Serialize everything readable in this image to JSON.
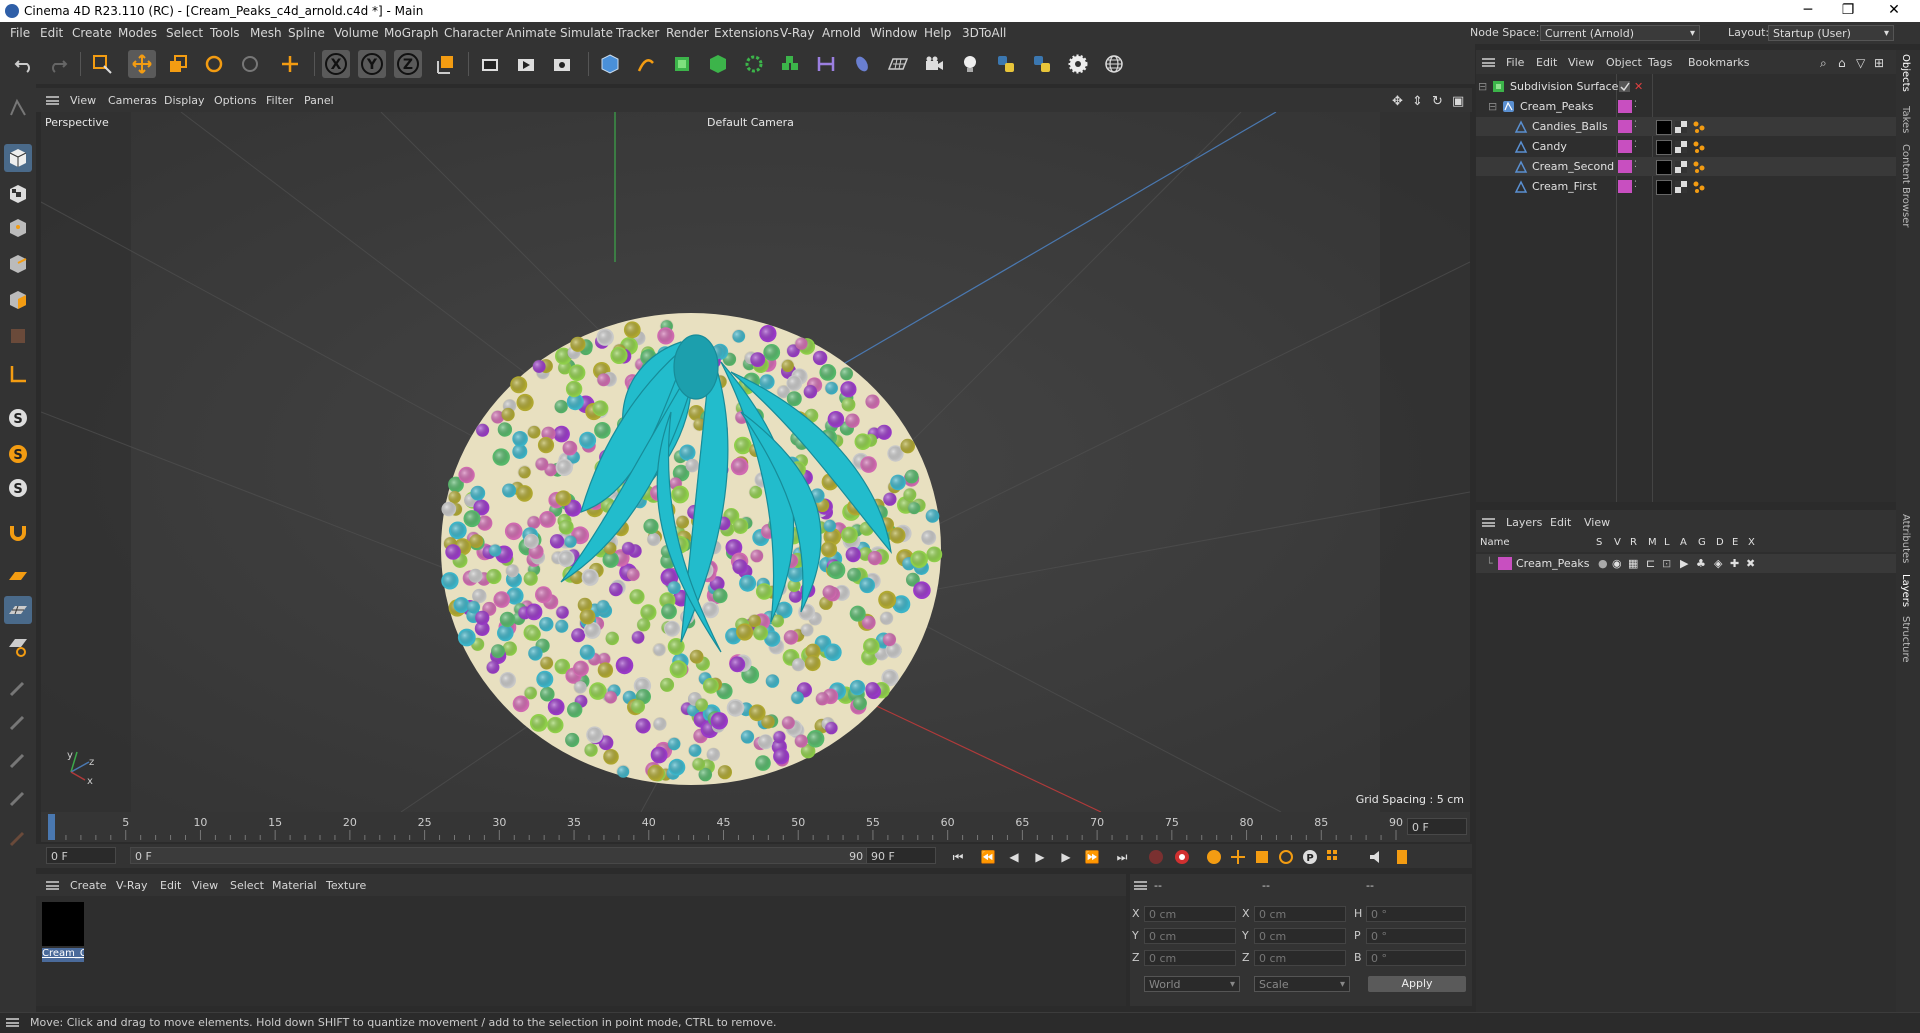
{
  "window": {
    "title": "Cinema 4D R23.110 (RC) - [Cream_Peaks_c4d_arnold.c4d *] - Main",
    "minimize": "─",
    "maximize": "❐",
    "close": "✕"
  },
  "menubar": {
    "items": [
      "File",
      "Edit",
      "Create",
      "Modes",
      "Select",
      "Tools",
      "Mesh",
      "Spline",
      "Volume",
      "MoGraph",
      "Character",
      "Animate",
      "Simulate",
      "Tracker",
      "Render",
      "Extensions",
      "V-Ray",
      "Arnold",
      "Window",
      "Help",
      "3DToAll"
    ],
    "node_space_label": "Node Space:",
    "node_space_value": "Current (Arnold)",
    "layout_label": "Layout:",
    "layout_value": "Startup (User)"
  },
  "viewport": {
    "menu": [
      "View",
      "Cameras",
      "Display",
      "Options",
      "Filter",
      "Panel"
    ],
    "projection": "Perspective",
    "camera": "Default Camera",
    "grid_spacing": "Grid Spacing : 5 cm",
    "axis_y": "y",
    "axis_z": "z",
    "axis_x": "x"
  },
  "timeline": {
    "ticks": [
      "0",
      "5",
      "10",
      "15",
      "20",
      "25",
      "30",
      "35",
      "40",
      "45",
      "50",
      "55",
      "60",
      "65",
      "70",
      "75",
      "80",
      "85",
      "90"
    ],
    "current_frame": "0 F",
    "start_frame": "0 F",
    "range_start": "0 F",
    "range_end": "90 F",
    "end_frame": "90 F"
  },
  "material_manager": {
    "menu": [
      "Create",
      "V-Ray",
      "Edit",
      "View",
      "Select",
      "Material",
      "Texture"
    ],
    "material_name": "Cream_C"
  },
  "coordinates": {
    "header": [
      "--",
      "--",
      "--"
    ],
    "rows": [
      {
        "l1": "X",
        "v1": "0 cm",
        "l2": "X",
        "v2": "0 cm",
        "l3": "H",
        "v3": "0 °"
      },
      {
        "l1": "Y",
        "v1": "0 cm",
        "l2": "Y",
        "v2": "0 cm",
        "l3": "P",
        "v3": "0 °"
      },
      {
        "l1": "Z",
        "v1": "0 cm",
        "l2": "Z",
        "v2": "0 cm",
        "l3": "B",
        "v3": "0 °"
      }
    ],
    "space": "World",
    "mode": "Scale",
    "apply": "Apply"
  },
  "object_manager": {
    "menu": [
      "File",
      "Edit",
      "View",
      "Object",
      "Tags",
      "Bookmarks"
    ],
    "objects": [
      {
        "name": "Subdivision Surface",
        "level": 0
      },
      {
        "name": "Cream_Peaks",
        "level": 1
      },
      {
        "name": "Candies_Balls",
        "level": 2
      },
      {
        "name": "Candy",
        "level": 2
      },
      {
        "name": "Cream_Second",
        "level": 2
      },
      {
        "name": "Cream_First",
        "level": 2
      }
    ],
    "layer_color": "#c84fc0"
  },
  "layer_manager": {
    "menu": [
      "Layers",
      "Edit",
      "View"
    ],
    "columns": [
      "Name",
      "S",
      "V",
      "R",
      "M",
      "L",
      "A",
      "G",
      "D",
      "E",
      "X"
    ],
    "layers": [
      {
        "name": "Cream_Peaks",
        "color": "#c84fc0"
      }
    ]
  },
  "right_tabs": [
    "Objects",
    "Takes",
    "Content Browser",
    "Attributes",
    "Layers",
    "Structure"
  ],
  "statusbar": {
    "text": "Move: Click and drag to move elements. Hold down SHIFT to quantize movement / add to the selection in point mode, CTRL to remove."
  },
  "colors": {
    "cream": "#22bccc",
    "candy_balls": [
      "#3cb4c8",
      "#8fcf4a",
      "#b0a830",
      "#9a3ac8",
      "#c8c8c8",
      "#56b86a",
      "#d06ab0"
    ],
    "accent_blue": "#4a78b0"
  }
}
